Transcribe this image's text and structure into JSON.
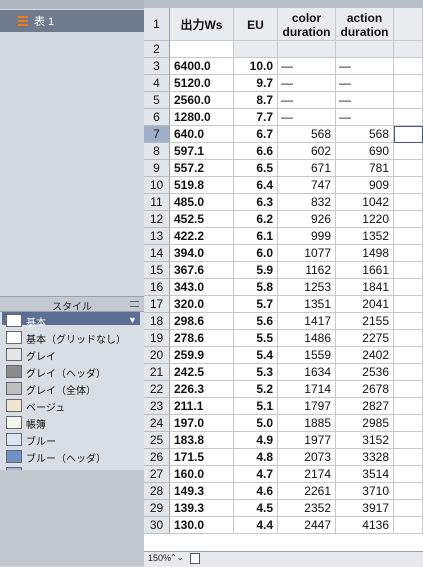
{
  "sidebar": {
    "sheet_item_label": "表 1",
    "styles_title": "スタイル",
    "styles": [
      {
        "label": "基本",
        "swatch": "#ffffff"
      },
      {
        "label": "基本（グリッドなし）",
        "swatch": "#ffffff"
      },
      {
        "label": "グレイ",
        "swatch": "#e6e6e6"
      },
      {
        "label": "グレイ（ヘッダ）",
        "swatch": "#8c8c8c"
      },
      {
        "label": "グレイ（全体）",
        "swatch": "#bdbdbd"
      },
      {
        "label": "ベージュ",
        "swatch": "#efe6cf"
      },
      {
        "label": "帳簿",
        "swatch": "#f2f7ec"
      },
      {
        "label": "ブルー",
        "swatch": "#dbe6f5"
      },
      {
        "label": "ブルー（ヘッダ）",
        "swatch": "#6f8fc7"
      },
      {
        "label": "ブルー（全体）",
        "swatch": "#9eb7df"
      }
    ],
    "dropdown_glyph": "▼"
  },
  "table": {
    "headers": [
      "出力Ws",
      "EU",
      "color\nduration",
      "action\nduration"
    ],
    "selected_row": 7,
    "rows": [
      {
        "n": "1",
        "cells": [
          "出力Ws",
          "EU",
          "color duration",
          "action duration"
        ]
      },
      {
        "n": "2",
        "cells": [
          "",
          "",
          "",
          ""
        ]
      },
      {
        "n": "3",
        "cells": [
          "6400.0",
          "10.0",
          "—",
          "—"
        ]
      },
      {
        "n": "4",
        "cells": [
          "5120.0",
          "9.7",
          "—",
          "—"
        ]
      },
      {
        "n": "5",
        "cells": [
          "2560.0",
          "8.7",
          "—",
          "—"
        ]
      },
      {
        "n": "6",
        "cells": [
          "1280.0",
          "7.7",
          "—",
          "—"
        ]
      },
      {
        "n": "7",
        "cells": [
          "640.0",
          "6.7",
          "568",
          "568"
        ]
      },
      {
        "n": "8",
        "cells": [
          "597.1",
          "6.6",
          "602",
          "690"
        ]
      },
      {
        "n": "9",
        "cells": [
          "557.2",
          "6.5",
          "671",
          "781"
        ]
      },
      {
        "n": "10",
        "cells": [
          "519.8",
          "6.4",
          "747",
          "909"
        ]
      },
      {
        "n": "11",
        "cells": [
          "485.0",
          "6.3",
          "832",
          "1042"
        ]
      },
      {
        "n": "12",
        "cells": [
          "452.5",
          "6.2",
          "926",
          "1220"
        ]
      },
      {
        "n": "13",
        "cells": [
          "422.2",
          "6.1",
          "999",
          "1352"
        ]
      },
      {
        "n": "14",
        "cells": [
          "394.0",
          "6.0",
          "1077",
          "1498"
        ]
      },
      {
        "n": "15",
        "cells": [
          "367.6",
          "5.9",
          "1162",
          "1661"
        ]
      },
      {
        "n": "16",
        "cells": [
          "343.0",
          "5.8",
          "1253",
          "1841"
        ]
      },
      {
        "n": "17",
        "cells": [
          "320.0",
          "5.7",
          "1351",
          "2041"
        ]
      },
      {
        "n": "18",
        "cells": [
          "298.6",
          "5.6",
          "1417",
          "2155"
        ]
      },
      {
        "n": "19",
        "cells": [
          "278.6",
          "5.5",
          "1486",
          "2275"
        ]
      },
      {
        "n": "20",
        "cells": [
          "259.9",
          "5.4",
          "1559",
          "2402"
        ]
      },
      {
        "n": "21",
        "cells": [
          "242.5",
          "5.3",
          "1634",
          "2536"
        ]
      },
      {
        "n": "22",
        "cells": [
          "226.3",
          "5.2",
          "1714",
          "2678"
        ]
      },
      {
        "n": "23",
        "cells": [
          "211.1",
          "5.1",
          "1797",
          "2827"
        ]
      },
      {
        "n": "24",
        "cells": [
          "197.0",
          "5.0",
          "1885",
          "2985"
        ]
      },
      {
        "n": "25",
        "cells": [
          "183.8",
          "4.9",
          "1977",
          "3152"
        ]
      },
      {
        "n": "26",
        "cells": [
          "171.5",
          "4.8",
          "2073",
          "3328"
        ]
      },
      {
        "n": "27",
        "cells": [
          "160.0",
          "4.7",
          "2174",
          "3514"
        ]
      },
      {
        "n": "28",
        "cells": [
          "149.3",
          "4.6",
          "2261",
          "3710"
        ]
      },
      {
        "n": "29",
        "cells": [
          "139.3",
          "4.5",
          "2352",
          "3917"
        ]
      },
      {
        "n": "30",
        "cells": [
          "130.0",
          "4.4",
          "2447",
          "4136"
        ]
      }
    ]
  },
  "footer": {
    "zoom": "150%",
    "zoom_arrows": "⌃⌄"
  },
  "colors": {
    "selection": "#9fb0c8",
    "sheet_icon": "#f07a1a",
    "style_selected": "#5a6f93"
  }
}
